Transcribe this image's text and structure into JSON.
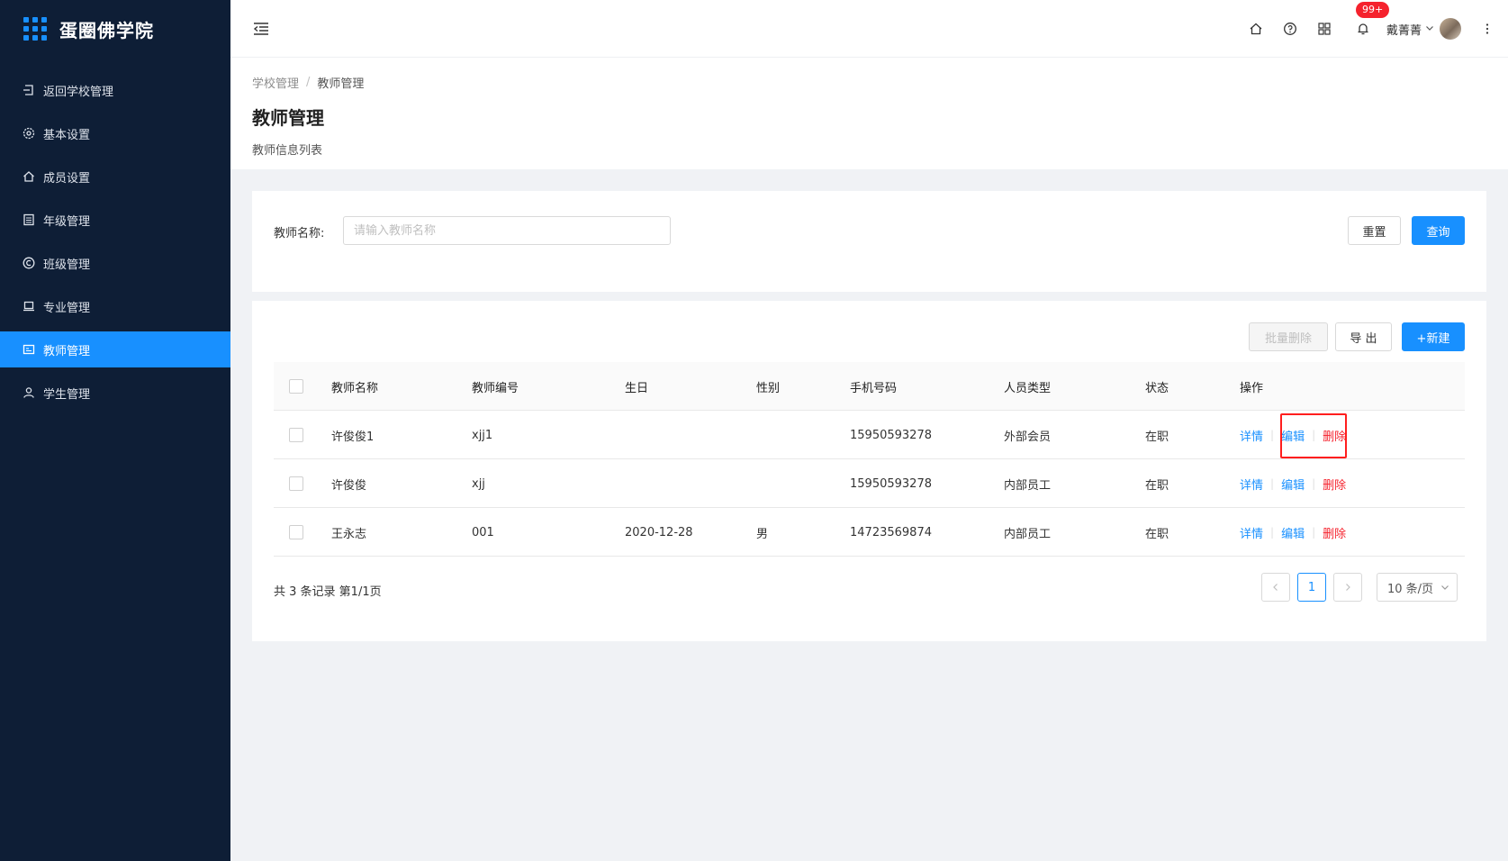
{
  "app": {
    "brand": "蛋圈佛学院"
  },
  "sidebar": {
    "items": [
      {
        "label": "返回学校管理",
        "icon": "back-icon",
        "active": false
      },
      {
        "label": "基本设置",
        "icon": "gear-icon",
        "active": false
      },
      {
        "label": "成员设置",
        "icon": "home-icon",
        "active": false
      },
      {
        "label": "年级管理",
        "icon": "list-icon",
        "active": false
      },
      {
        "label": "班级管理",
        "icon": "copyright-icon",
        "active": false
      },
      {
        "label": "专业管理",
        "icon": "laptop-icon",
        "active": false
      },
      {
        "label": "教师管理",
        "icon": "id-card-icon",
        "active": true
      },
      {
        "label": "学生管理",
        "icon": "user-icon",
        "active": false
      }
    ]
  },
  "header": {
    "notification_badge": "99+",
    "username": "戴菁菁"
  },
  "breadcrumb": {
    "parent": "学校管理",
    "separator": "/",
    "current": "教师管理"
  },
  "page": {
    "title": "教师管理",
    "description": "教师信息列表"
  },
  "search": {
    "label": "教师名称:",
    "placeholder": "请输入教师名称",
    "value": "",
    "reset_label": "重置",
    "query_label": "查询"
  },
  "toolbar": {
    "batch_delete_label": "批量删除",
    "export_label": "导 出",
    "new_label": "+新建"
  },
  "table": {
    "columns": [
      "教师名称",
      "教师编号",
      "生日",
      "性别",
      "手机号码",
      "人员类型",
      "状态",
      "操作"
    ],
    "rows": [
      {
        "name": "许俊俊1",
        "code": "xjj1",
        "birthday": "",
        "gender": "",
        "phone": "15950593278",
        "type": "外部会员",
        "status": "在职"
      },
      {
        "name": "许俊俊",
        "code": "xjj",
        "birthday": "",
        "gender": "",
        "phone": "15950593278",
        "type": "内部员工",
        "status": "在职"
      },
      {
        "name": "王永志",
        "code": "001",
        "birthday": "2020-12-28",
        "gender": "男",
        "phone": "14723569874",
        "type": "内部员工",
        "status": "在职"
      }
    ],
    "actions": {
      "detail": "详情",
      "edit": "编辑",
      "delete": "删除"
    }
  },
  "pagination": {
    "summary": "共 3 条记录 第1/1页",
    "current_page": "1",
    "page_size": "10 条/页"
  },
  "colors": {
    "accent": "#1890ff",
    "danger": "#f5222d",
    "sidebar_bg": "#0e1e36",
    "highlight": "#ff1e1e"
  }
}
